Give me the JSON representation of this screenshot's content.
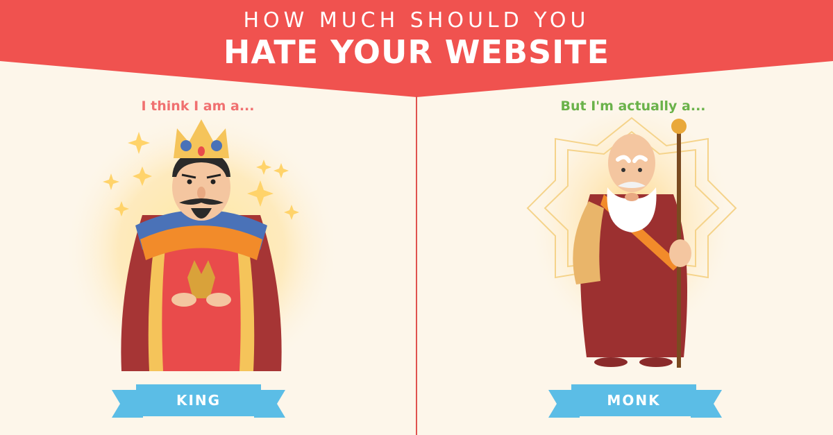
{
  "header": {
    "line1": "HOW MUCH SHOULD YOU",
    "line2": "HATE YOUR WEBSITE"
  },
  "left_panel": {
    "caption": "I think I am a...",
    "label": "KING",
    "character": "king-icon"
  },
  "right_panel": {
    "caption": "But I'm actually a...",
    "label": "MONK",
    "character": "monk-icon"
  },
  "colors": {
    "banner": "#f0524f",
    "background": "#fdf6ea",
    "ribbon": "#5bbde6",
    "ribbon_dark": "#3a9ccc",
    "left_caption": "#f07070",
    "right_caption": "#6ab24a",
    "divider": "#e0524f"
  }
}
